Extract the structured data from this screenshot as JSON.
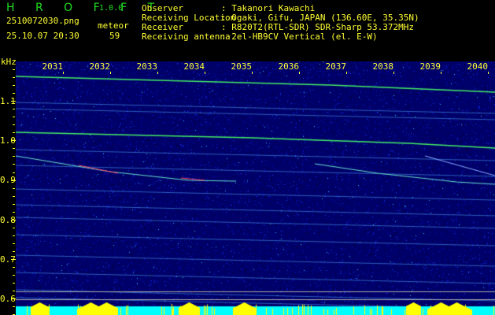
{
  "app": {
    "name": "H R O F F T",
    "version": "1.0.0"
  },
  "file": {
    "name": "2510072030.png",
    "datetime": "25.10.07 20:30"
  },
  "meteor": {
    "label": "meteor",
    "count": "59"
  },
  "info": [
    {
      "label": "Observer",
      "value": ": Takanori Kawachi"
    },
    {
      "label": "Receiving Location",
      "value": ": Ogaki, Gifu, JAPAN (136.60E, 35.35N)"
    },
    {
      "label": "Receiver",
      "value": ": R820T2(RTL-SDR) SDR-Sharp 53.372MHz"
    },
    {
      "label": "Receiving antenna",
      "value": ": 2el-HB9CV Vertical (el. E-W)"
    }
  ],
  "spectrogram": {
    "y_unit": "kHz",
    "x_ticks": [
      "2031",
      "2032",
      "2033",
      "2034",
      "2035",
      "2036",
      "2037",
      "2038",
      "2039",
      "2040"
    ],
    "y_ticks": [
      "1.1",
      "1.0",
      "0.9",
      "0.8",
      "0.7",
      "0.6"
    ],
    "colors": {
      "text": "#ffff33",
      "background": "#000080",
      "signal": "#00ff66",
      "strip": "#00ffff"
    }
  }
}
